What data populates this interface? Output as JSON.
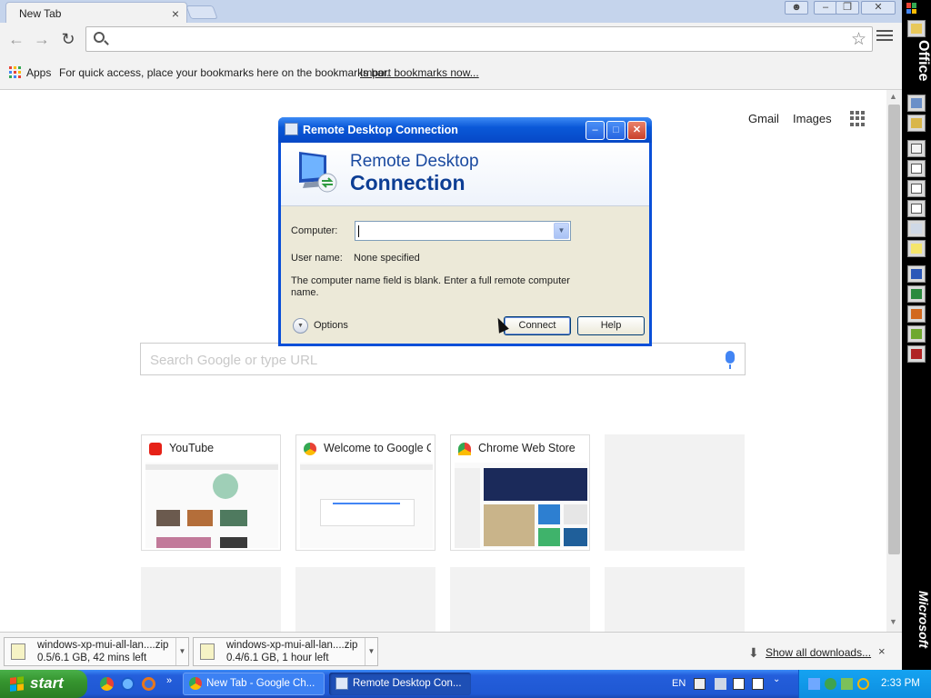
{
  "browser": {
    "tab_title": "New Tab",
    "tab_close": "×",
    "bookmarks": {
      "apps_label": "Apps",
      "hint_text": "For quick access, place your bookmarks here on the bookmarks bar.",
      "import_link": "Import bookmarks now..."
    }
  },
  "page": {
    "gmail": "Gmail",
    "images": "Images",
    "search_placeholder": "Search Google or type URL",
    "tiles": [
      {
        "title": "YouTube"
      },
      {
        "title": "Welcome to Google Chrome"
      },
      {
        "title": "Chrome Web Store"
      }
    ]
  },
  "downloads": {
    "items": [
      {
        "name": "windows-xp-mui-all-lan....zip",
        "status": "0.5/6.1 GB, 42 mins left"
      },
      {
        "name": "windows-xp-mui-all-lan....zip",
        "status": "0.4/6.1 GB, 1 hour left"
      }
    ],
    "show_all": "Show all downloads...",
    "close": "×"
  },
  "office_bar": {
    "title": "Office",
    "vendor": "Microsoft"
  },
  "rdc_dialog": {
    "window_title": "Remote Desktop Connection",
    "banner_line1": "Remote Desktop",
    "banner_line2": "Connection",
    "computer_label": "Computer:",
    "computer_value": "",
    "username_label": "User name:",
    "username_value": "None specified",
    "message": "The computer name field is blank. Enter a full remote computer name.",
    "options_label": "Options",
    "connect_label": "Connect",
    "help_label": "Help"
  },
  "taskbar": {
    "start_label": "start",
    "tasks": [
      {
        "label": "New Tab - Google Ch..."
      },
      {
        "label": "Remote Desktop Con..."
      }
    ],
    "language": "EN",
    "clock": "2:33 PM"
  },
  "colors": {
    "xp_blue": "#0a58d8",
    "start_green": "#36952f",
    "google_blue": "#4285f4"
  }
}
